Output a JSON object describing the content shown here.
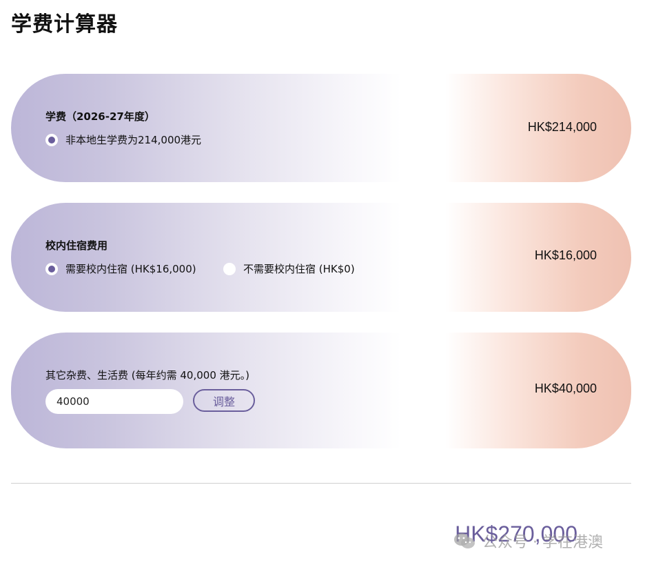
{
  "page": {
    "title": "学费计算器"
  },
  "tuition": {
    "label": "学费（2026-27年度）",
    "option": "非本地生学费为214,000港元",
    "amount": "HK$214,000"
  },
  "housing": {
    "label": "校内住宿费用",
    "options": [
      {
        "text": "需要校内住宿 (HK$16,000)",
        "selected": true
      },
      {
        "text": "不需要校内住宿 (HK$0)",
        "selected": false
      }
    ],
    "amount": "HK$16,000"
  },
  "misc": {
    "label": "其它杂费、生活费 (每年约需 40,000 港元。)",
    "input_value": "40000",
    "button_label": "调整",
    "amount": "HK$40,000"
  },
  "total": "HK$270,000",
  "watermark": {
    "text": "公众号 · 学在港澳",
    "icon": "wechat-icon"
  },
  "colors": {
    "accent": "#6a5e9c",
    "gradient_left": "#bcb6d8",
    "gradient_right": "#efc1b2"
  }
}
